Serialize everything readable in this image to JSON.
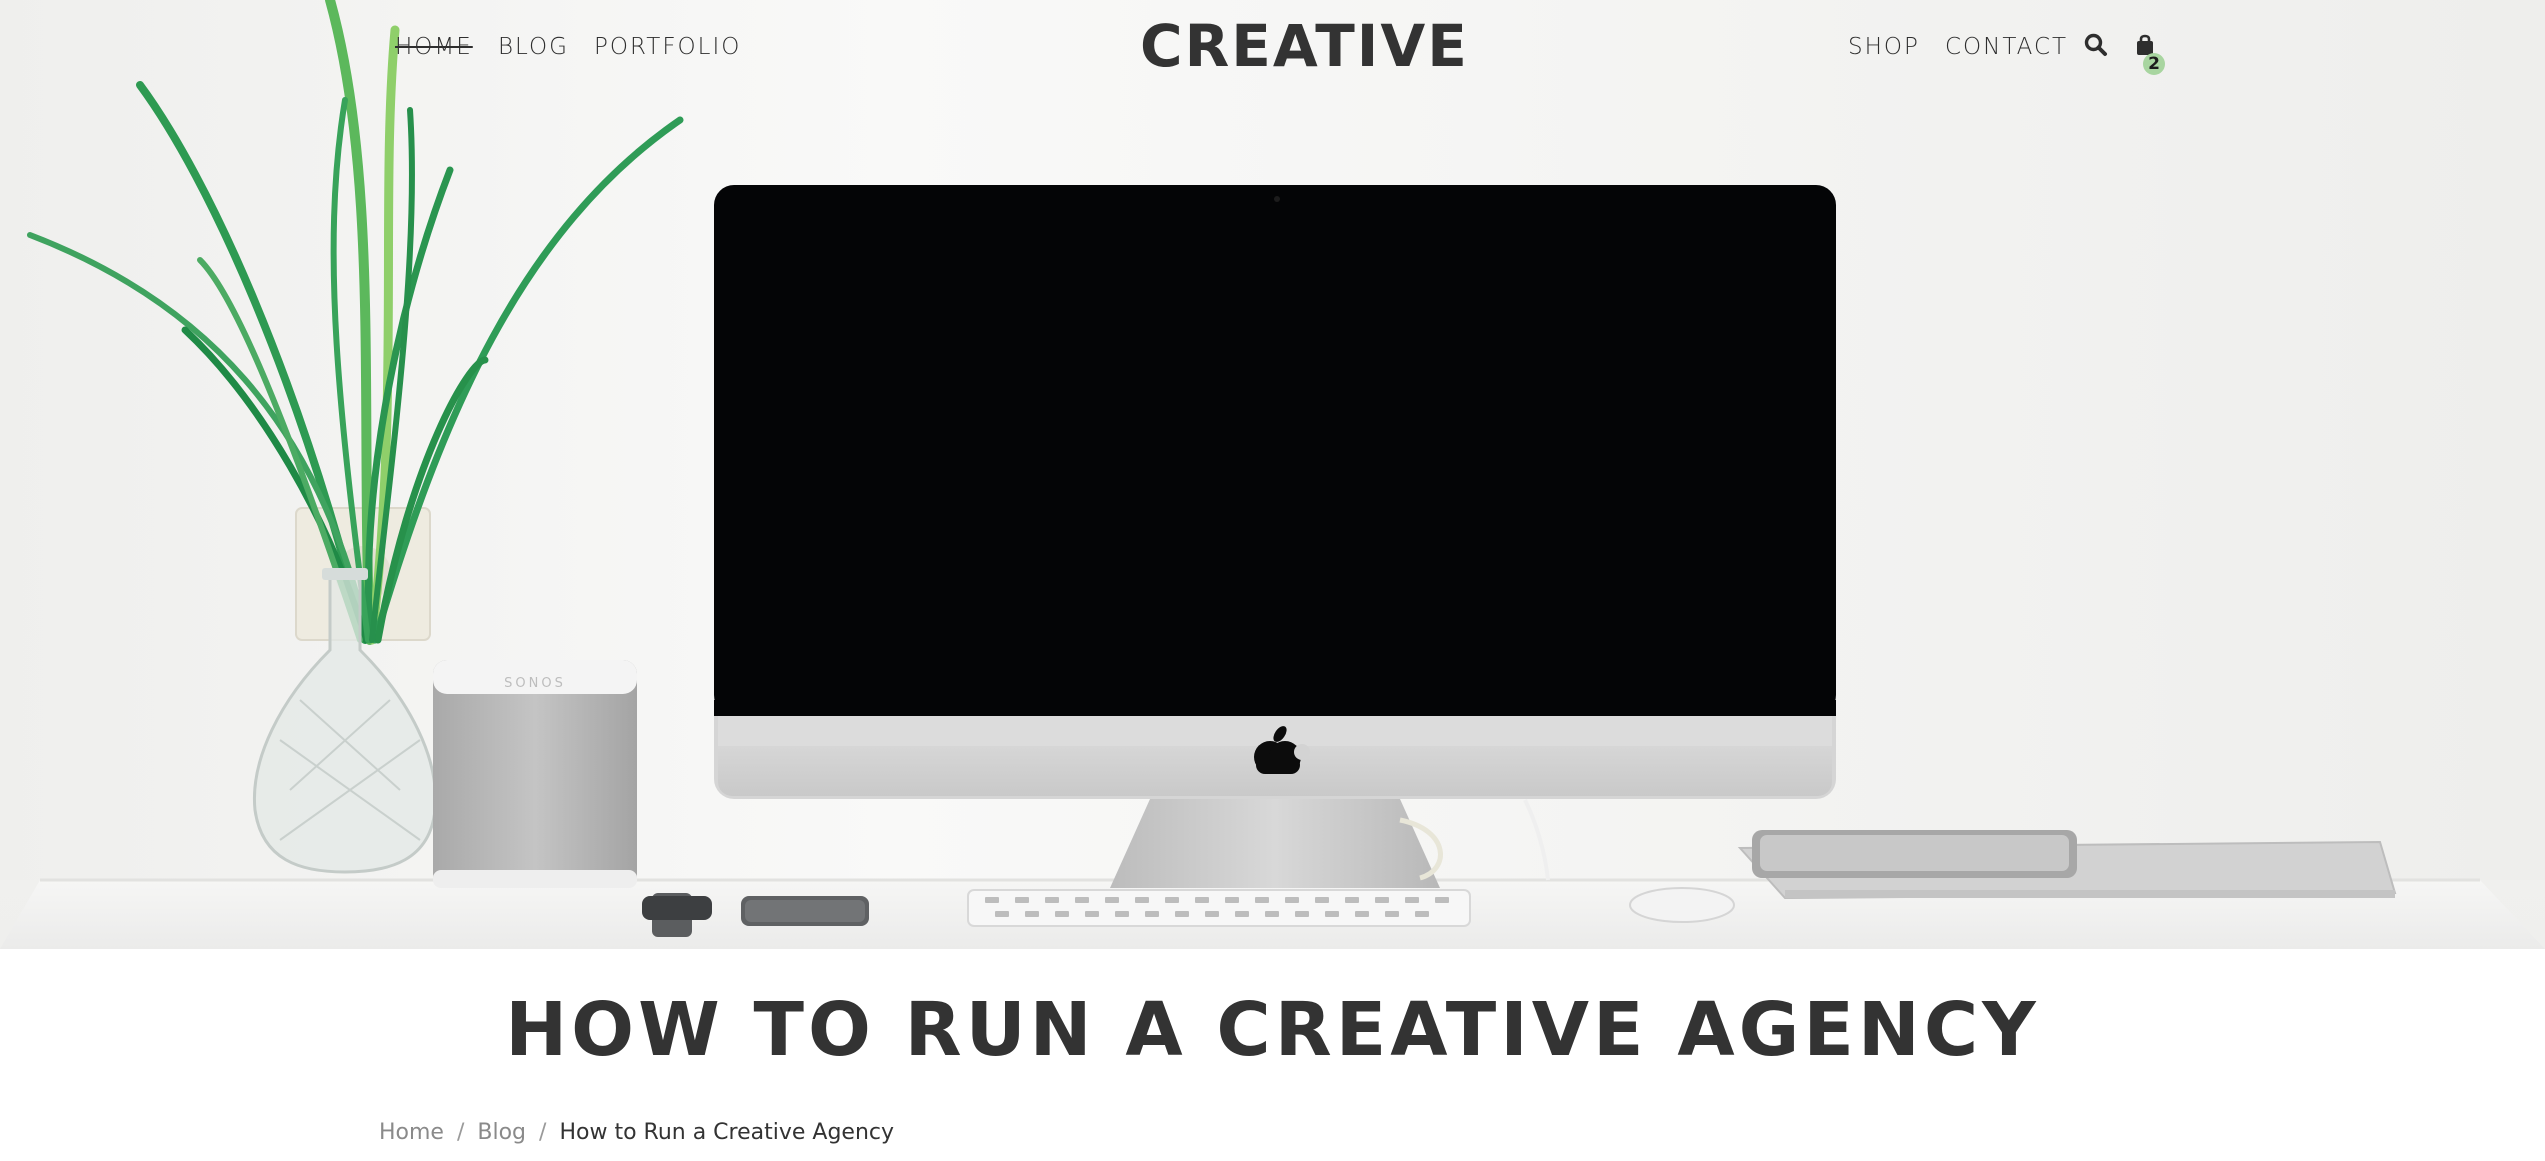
{
  "nav": {
    "left": [
      {
        "label": "HOME",
        "active": true
      },
      {
        "label": "BLOG",
        "active": false
      },
      {
        "label": "PORTFOLIO",
        "active": false
      }
    ],
    "brand": "CREATIVE",
    "right": [
      {
        "label": "SHOP"
      },
      {
        "label": "CONTACT"
      }
    ],
    "icons": {
      "search": "search-icon",
      "cart": "shopping-bag-icon"
    },
    "cart_count": "2"
  },
  "hero": {
    "image_subject": "desk-with-computer",
    "speaker_label": "SONOS"
  },
  "post": {
    "title": "HOW TO RUN A CREATIVE AGENCY"
  },
  "breadcrumb": {
    "items": [
      {
        "label": "Home"
      },
      {
        "label": "Blog"
      }
    ],
    "separator": "/",
    "current": "How to Run a Creative Agency"
  },
  "colors": {
    "text": "#333333",
    "muted": "#8a8a8a",
    "badge": "#a8d5a0",
    "hero_bg": "#f4f4f2",
    "plant_green": "#2e9a52"
  }
}
